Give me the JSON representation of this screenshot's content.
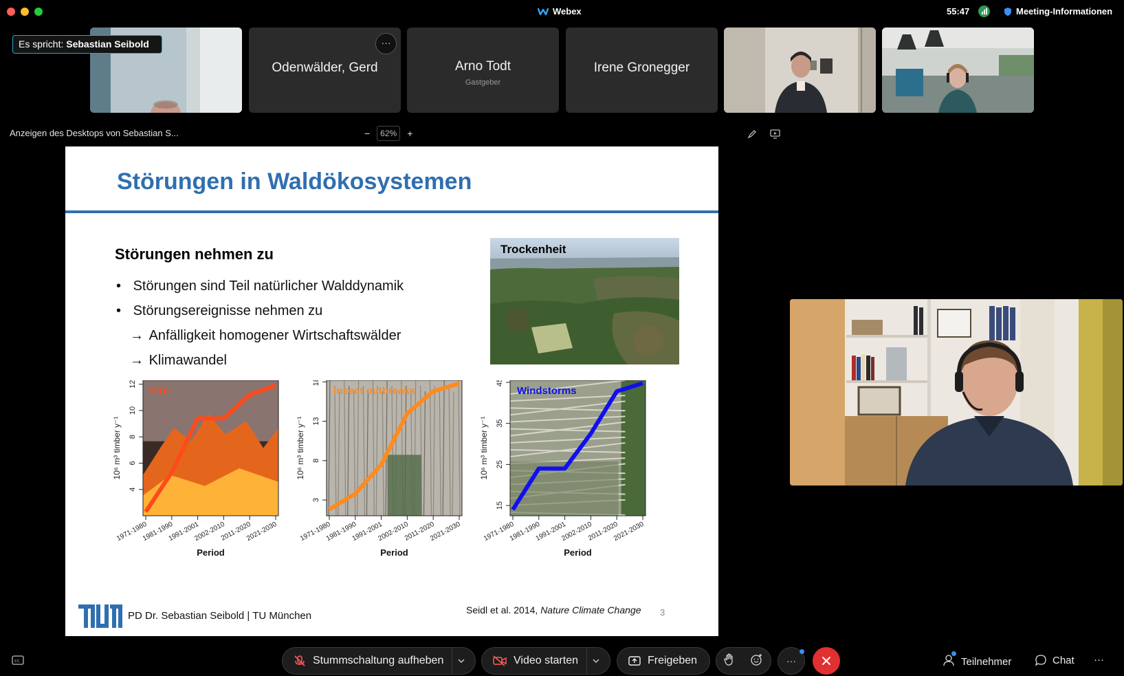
{
  "window": {
    "app_title": "Webex",
    "timer": "55:47",
    "meeting_info": "Meeting-Informationen"
  },
  "speaker": {
    "prefix": "Es spricht:",
    "name": "Sebastian Seibold"
  },
  "participants": [
    {
      "name": "",
      "role": ""
    },
    {
      "name": "Odenwälder, Gerd",
      "role": ""
    },
    {
      "name": "Arno Todt",
      "role": "Gastgeber"
    },
    {
      "name": "Irene Gronegger",
      "role": ""
    }
  ],
  "share": {
    "title": "Anzeigen des Desktops von Sebastian S...",
    "zoom": "62%",
    "zoom_minus": "−",
    "zoom_plus": "+"
  },
  "slide": {
    "title": "Störungen in Waldökosystemen",
    "subtitle": "Störungen nehmen zu",
    "bullets": [
      "Störungen sind Teil natürlicher Walddynamik",
      "Störungsereignisse nehmen zu",
      "Anfälligkeit homogener Wirtschaftswälder",
      "Klimawandel"
    ],
    "bullet_marker": "•",
    "arrow_marker": "→",
    "photo_label": "Trockenheit",
    "footer_name": "PD Dr. Sebastian Seibold | TU München",
    "citation_authors": "Seidl et al. 2014,",
    "citation_journal": "Nature Climate Change",
    "page_number": "3"
  },
  "chart_data": [
    {
      "type": "line",
      "title": "Fire",
      "xlabel": "Period",
      "ylabel": "10⁶ m³ timber y⁻¹",
      "categories": [
        "1971-1980",
        "1981-1990",
        "1991-2001",
        "2002-2010",
        "2011-2020",
        "2021-2030"
      ],
      "values": [
        2.3,
        5.3,
        9.4,
        9.4,
        11.2,
        11.9
      ],
      "yticks": [
        4,
        6,
        8,
        10,
        12
      ],
      "ylim": [
        2,
        12.3
      ],
      "color": "#ff4a1a"
    },
    {
      "type": "line",
      "title": "Insect outbreaks",
      "xlabel": "Period",
      "ylabel": "10⁶ m³ timber y⁻¹",
      "categories": [
        "1971-1980",
        "1981-1990",
        "1991-2001",
        "2002-2010",
        "2011-2020",
        "2021-2030"
      ],
      "values": [
        1.8,
        3.8,
        7.5,
        14.0,
        16.8,
        17.8
      ],
      "yticks": [
        3,
        8,
        13,
        18
      ],
      "ylim": [
        1,
        18.2
      ],
      "color": "#ff8a1e"
    },
    {
      "type": "line",
      "title": "Windstorms",
      "xlabel": "Period",
      "ylabel": "10⁶ m³ timber y⁻¹",
      "categories": [
        "1971-1980",
        "1981-1990",
        "1991-2001",
        "2002-2010",
        "2011-2020",
        "2021-2030"
      ],
      "values": [
        14.0,
        24.0,
        24.0,
        32.5,
        42.8,
        44.8
      ],
      "yticks": [
        15,
        25,
        35,
        45
      ],
      "ylim": [
        12.5,
        45.5
      ],
      "color": "#1010ee"
    }
  ],
  "toolbar": {
    "unmute": "Stummschaltung aufheben",
    "video": "Video starten",
    "share": "Freigeben",
    "more": "···",
    "participants": "Teilnehmer",
    "chat": "Chat",
    "overflow": "···"
  }
}
